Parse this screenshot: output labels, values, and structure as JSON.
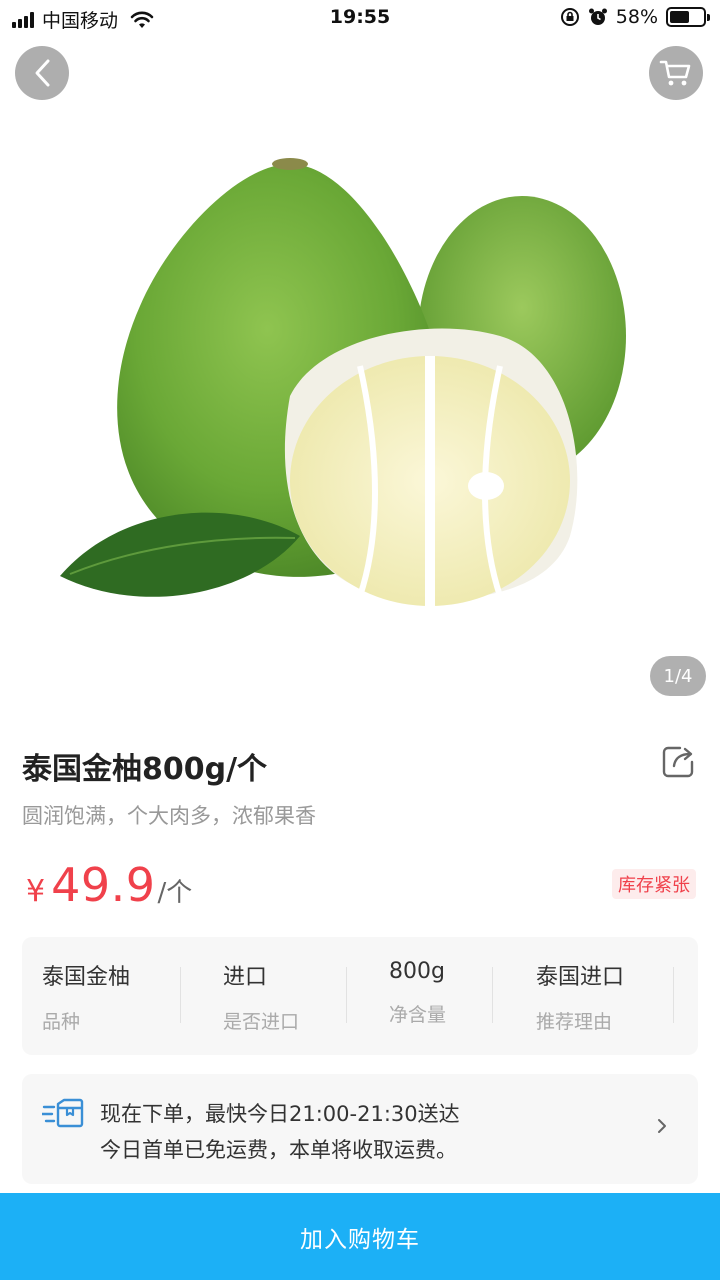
{
  "status_bar": {
    "carrier": "中国移动",
    "time": "19:55",
    "battery": "58%",
    "battery_level": 0.58
  },
  "nav": {
    "back_icon": "chevron-left-icon",
    "cart_icon": "shopping-cart-icon"
  },
  "gallery": {
    "pager": "1/4",
    "current": 1,
    "total": 4
  },
  "product": {
    "title": "泰国金柚800g/个",
    "subtitle": "圆润饱满，个大肉多，浓郁果香",
    "currency": "¥",
    "price": "49.9",
    "unit": "/个",
    "stock_badge": "库存紧张"
  },
  "attributes": [
    {
      "value": "泰国金柚",
      "label": "品种"
    },
    {
      "value": "进口",
      "label": "是否进口"
    },
    {
      "value": "800g",
      "label": "净含量"
    },
    {
      "value": "泰国进口",
      "label": "推荐理由"
    }
  ],
  "delivery": {
    "line1": "现在下单，最快今日21:00-21:30送达",
    "line2": "今日首单已免运费，本单将收取运费。"
  },
  "cta": {
    "label": "加入购物车"
  },
  "colors": {
    "price": "#f0414b",
    "cta": "#1cb0f6",
    "accent_icon": "#3a8fd6"
  }
}
